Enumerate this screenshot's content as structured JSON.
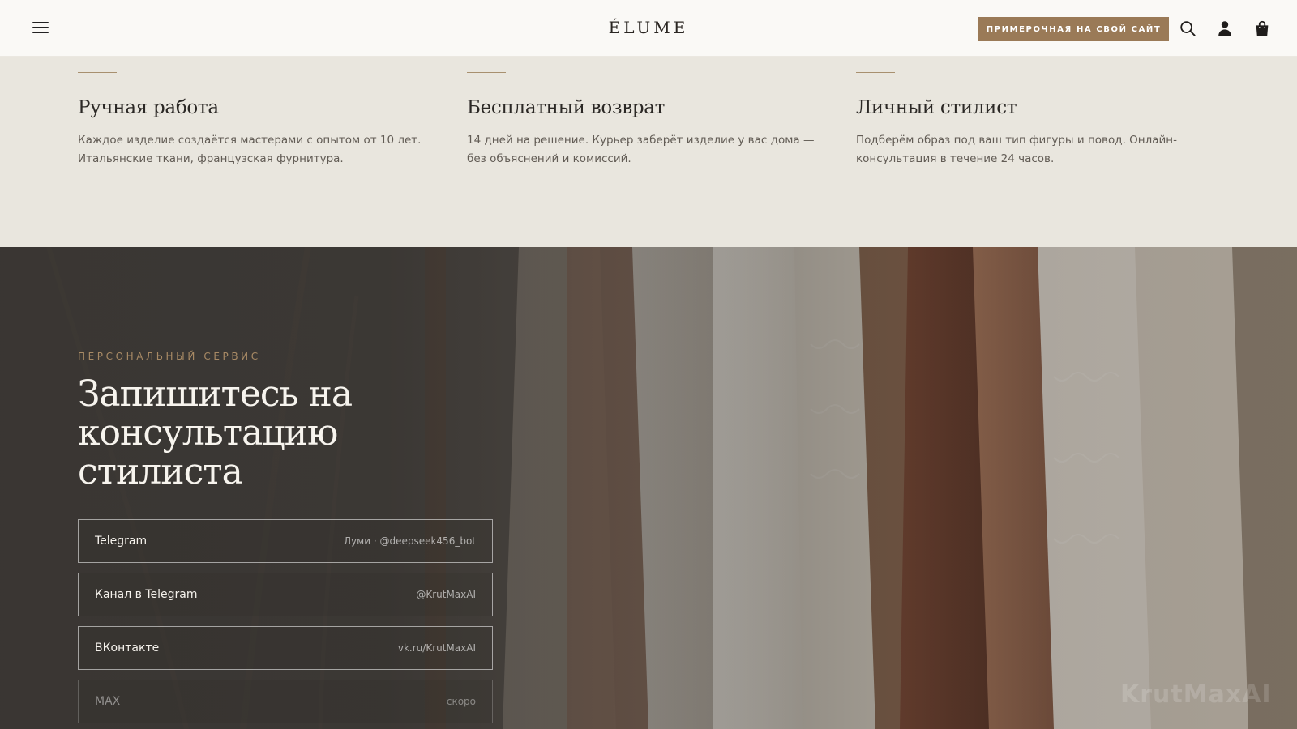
{
  "header": {
    "logo": "ÉLUME",
    "cta_label": "ПРИМЕРОЧНАЯ НА СВОЙ САЙТ",
    "icons": [
      "menu-icon",
      "search-icon",
      "user-icon",
      "shopping-bag-icon"
    ]
  },
  "features": [
    {
      "title": "Ручная работа",
      "text": "Каждое изделие создаётся мастерами с опытом от 10 лет. Итальянские ткани, французская фурнитура."
    },
    {
      "title": "Бесплатный возврат",
      "text": "14 дней на решение. Курьер заберёт изделие у вас дома — без объяснений и комиссий."
    },
    {
      "title": "Личный стилист",
      "text": "Подберём образ под ваш тип фигуры и повод. Онлайн-консультация в течение 24 часов."
    }
  ],
  "hero": {
    "eyebrow": "ПЕРСОНАЛЬНЫЙ СЕРВИС",
    "title": "Запишитесь на консультацию стилиста",
    "contacts": [
      {
        "label": "Telegram",
        "value": "Луми · @deepseek456_bot"
      },
      {
        "label": "Канал в Telegram",
        "value": "@KrutMaxAI"
      },
      {
        "label": "ВКонтакте",
        "value": "vk.ru/KrutMaxAI"
      },
      {
        "label": "MAX",
        "value": "скоро"
      }
    ],
    "watermark": "KrutMaxAI"
  },
  "colors": {
    "accent": "#9a7a57",
    "header_bg": "#faf9f6",
    "features_bg": "#e9e6de",
    "hero_bg": "#3e3a36"
  }
}
